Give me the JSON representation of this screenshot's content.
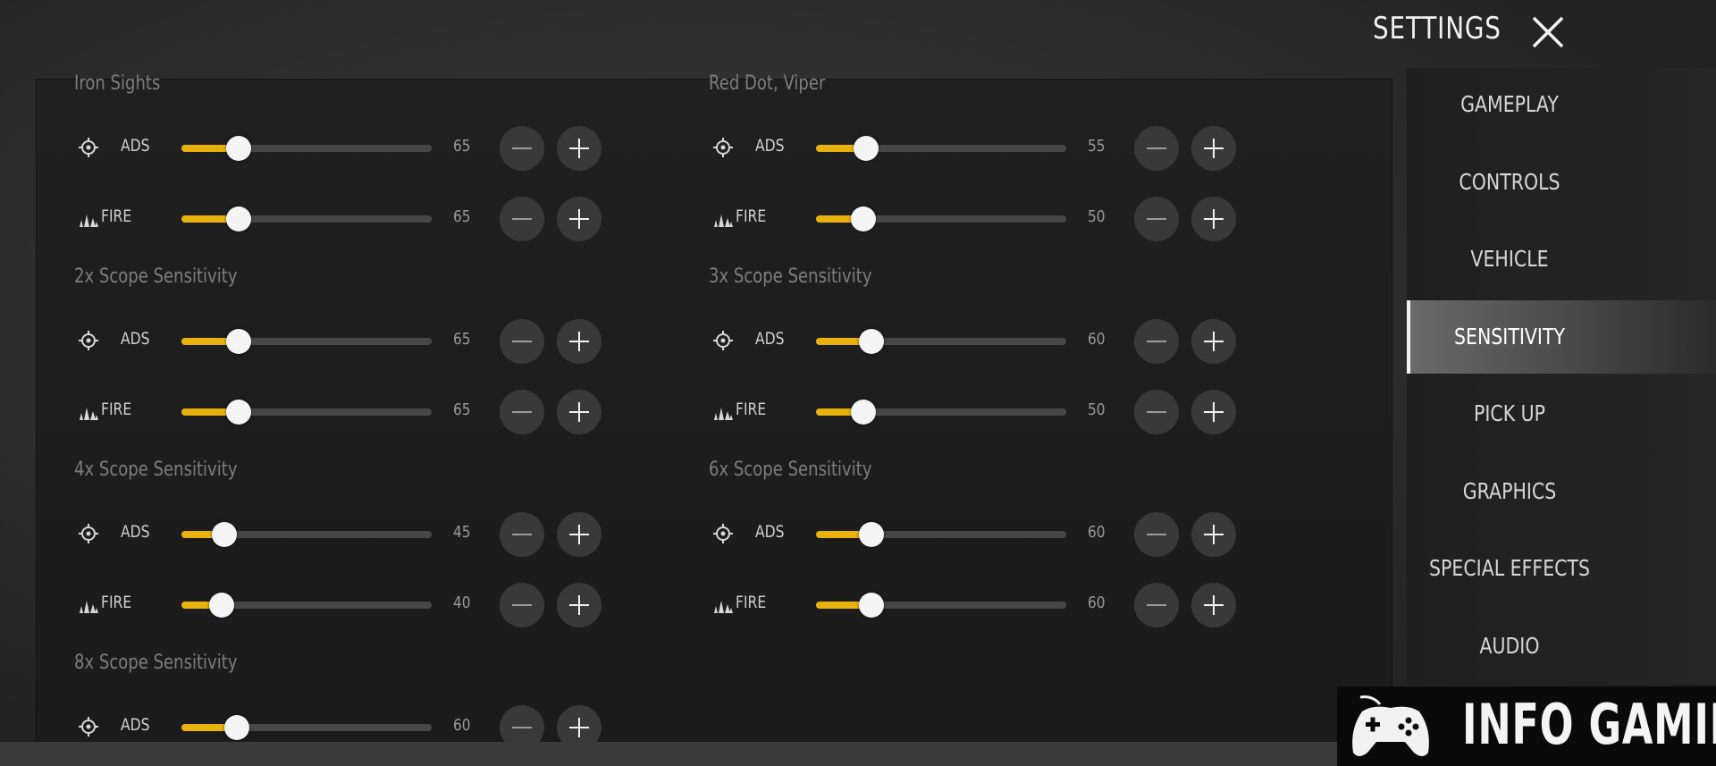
{
  "header": {
    "title": "SETTINGS"
  },
  "sections": [
    {
      "title": "Iron Sights",
      "rows": [
        {
          "label": "ADS",
          "value": "65",
          "fill": 0.23
        },
        {
          "label": "FIRE",
          "value": "65",
          "fill": 0.23
        }
      ]
    },
    {
      "title": "Red Dot, Viper",
      "rows": [
        {
          "label": "ADS",
          "value": "55",
          "fill": 0.2
        },
        {
          "label": "FIRE",
          "value": "50",
          "fill": 0.19
        }
      ]
    },
    {
      "title": "2x Scope Sensitivity",
      "rows": [
        {
          "label": "ADS",
          "value": "65",
          "fill": 0.23
        },
        {
          "label": "FIRE",
          "value": "65",
          "fill": 0.23
        }
      ]
    },
    {
      "title": "3x Scope Sensitivity",
      "rows": [
        {
          "label": "ADS",
          "value": "60",
          "fill": 0.22
        },
        {
          "label": "FIRE",
          "value": "50",
          "fill": 0.19
        }
      ]
    },
    {
      "title": "4x Scope Sensitivity",
      "rows": [
        {
          "label": "ADS",
          "value": "45",
          "fill": 0.17
        },
        {
          "label": "FIRE",
          "value": "40",
          "fill": 0.16
        }
      ]
    },
    {
      "title": "6x Scope Sensitivity",
      "rows": [
        {
          "label": "ADS",
          "value": "60",
          "fill": 0.22
        },
        {
          "label": "FIRE",
          "value": "60",
          "fill": 0.22
        }
      ]
    },
    {
      "title": "8x Scope Sensitivity",
      "rows": [
        {
          "label": "ADS",
          "value": "60",
          "fill": 0.22
        }
      ]
    }
  ],
  "nav": {
    "items": [
      {
        "label": "GAMEPLAY"
      },
      {
        "label": "CONTROLS"
      },
      {
        "label": "VEHICLE"
      },
      {
        "label": "SENSITIVITY"
      },
      {
        "label": "PICK UP"
      },
      {
        "label": "GRAPHICS"
      },
      {
        "label": "SPECIAL EFFECTS"
      },
      {
        "label": "AUDIO"
      }
    ],
    "active": "SENSITIVITY"
  },
  "watermark": {
    "text": "INFO GAMING"
  },
  "icons": {
    "ads": "crosshair-icon",
    "fire": "fire-burst-icon",
    "close": "close-icon",
    "logo": "gamepad-icon"
  },
  "colors": {
    "accent": "#e8b10c",
    "track": "#474747",
    "button": "#393939"
  }
}
